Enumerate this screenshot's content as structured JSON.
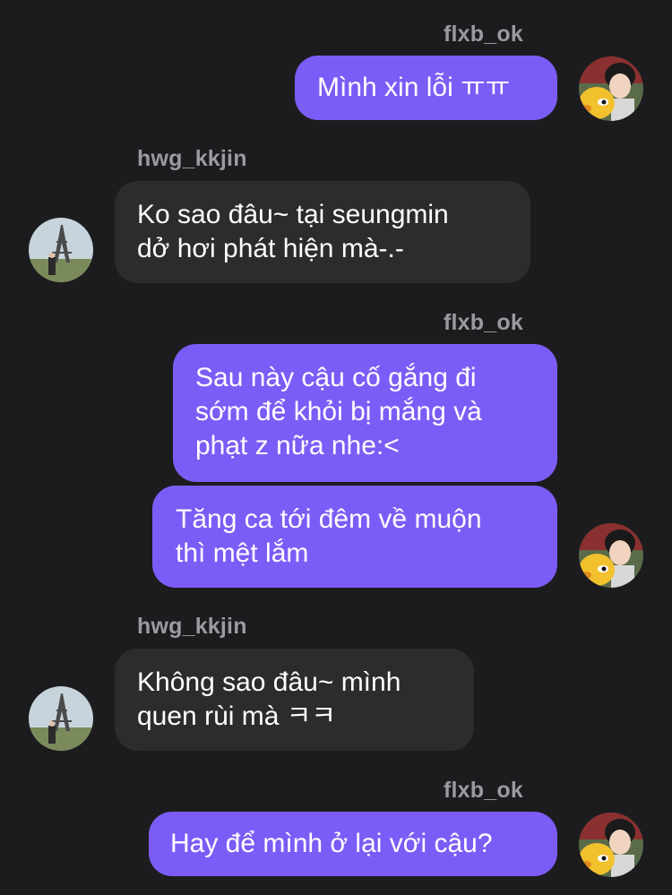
{
  "messages": [
    {
      "sender": "flxb_ok",
      "text": "Mình xin lỗi ㅠㅠ"
    },
    {
      "sender": "hwg_kkjin",
      "lines": [
        "Ko sao đâu~ tại seungmin",
        "dở hơi phát hiện mà-.-"
      ]
    },
    {
      "sender": "flxb_ok",
      "lines": [
        "Sau này cậu cố gắng đi",
        "sớm để khỏi bị mắng và",
        "phạt z nữa nhe:<"
      ]
    },
    {
      "lines": [
        "Tăng ca tới đêm về muộn",
        "thì mệt lắm"
      ]
    },
    {
      "sender": "hwg_kkjin",
      "lines": [
        "Không sao đâu~ mình",
        "quen rùi mà ㅋㅋ"
      ]
    },
    {
      "sender": "flxb_ok",
      "text": "Hay để mình ở lại với cậu?"
    }
  ],
  "colors": {
    "background": "#1c1c1e",
    "my_bubble": "#7c5cf6",
    "their_bubble": "#2c2c2e",
    "username": "#9a9aa0"
  },
  "avatars": {
    "me": "avatar-person-with-yellow-duck-icon",
    "them": "avatar-eiffel-tower-photo-icon"
  }
}
